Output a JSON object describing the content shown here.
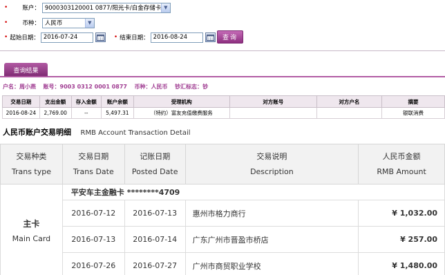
{
  "query": {
    "account_label": "账户：",
    "account_value": "9000303120001 0877/阳光卡/白金存储卡",
    "currency_label": "币种：",
    "currency_value": "人民币",
    "start_label": "起始日期：",
    "start_value": "2016-07-24",
    "end_label": "结束日期：",
    "end_value": "2016-08-24",
    "query_button": "查询"
  },
  "results_tab": "查询结果",
  "info": {
    "name_label": "户名：",
    "name": "周小燕",
    "account_label": "账号：",
    "account": "9003 0312 0001 0877",
    "currency_label": "币种：",
    "currency": "人民币",
    "cash_label": "钞汇标志：",
    "cash": "钞"
  },
  "grid": {
    "headers": [
      "交易日期",
      "支出金额",
      "存入金额",
      "账户余额",
      "受理机构",
      "对方账号",
      "对方户名",
      "摘要"
    ],
    "rows": [
      [
        "2016-08-24",
        "2,769.00",
        "--",
        "5,497.31",
        "（特约）富友充值缴费服务",
        "",
        "",
        "银联消费"
      ]
    ]
  },
  "statement": {
    "title_cn": "人民币账户交易明细",
    "title_en": "RMB Account Transaction Detail",
    "headers": [
      {
        "cn": "交易种类",
        "en": "Trans type"
      },
      {
        "cn": "交易日期",
        "en": "Trans Date"
      },
      {
        "cn": "记账日期",
        "en": "Posted Date"
      },
      {
        "cn": "交易说明",
        "en": "Description"
      },
      {
        "cn": "人民币金额",
        "en": "RMB Amount"
      }
    ],
    "group_title": "平安车主金融卡 ********4709",
    "card_type_cn": "主卡",
    "card_type_en": "Main Card",
    "rows": [
      {
        "trans_date": "2016-07-12",
        "posted_date": "2016-07-13",
        "description": "惠州市格力商行",
        "amount": "¥ 1,032.00"
      },
      {
        "trans_date": "2016-07-13",
        "posted_date": "2016-07-14",
        "description": "广东广州市晋盈市桥店",
        "amount": "¥ 257.00"
      },
      {
        "trans_date": "2016-07-26",
        "posted_date": "2016-07-27",
        "description": "广州市商贸职业学校",
        "amount": "¥ 1,480.00"
      }
    ]
  }
}
